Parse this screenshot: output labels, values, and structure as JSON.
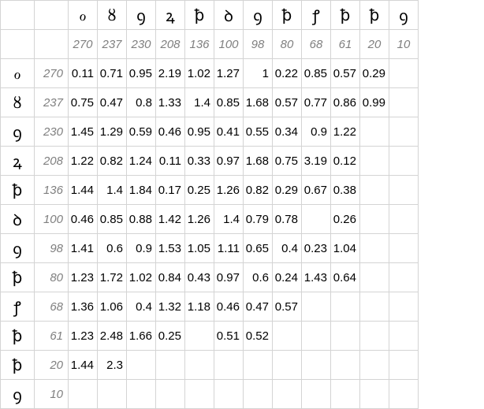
{
  "symbols": [
    "ℴ",
    "ȣ",
    "ꝯ",
    "ꝝ",
    "ꝥ",
    "ꝺ",
    "ꝯ",
    "ꝥ",
    "ꝭ",
    "ꝥ",
    "ꝥ",
    "ꝯ"
  ],
  "counts": [
    "270",
    "237",
    "230",
    "208",
    "136",
    "100",
    "98",
    "80",
    "68",
    "61",
    "20",
    "10"
  ],
  "rows": [
    [
      "0.11",
      "0.71",
      "0.95",
      "2.19",
      "1.02",
      "1.27",
      "1",
      "0.22",
      "0.85",
      "0.57",
      "0.29",
      ""
    ],
    [
      "0.75",
      "0.47",
      "0.8",
      "1.33",
      "1.4",
      "0.85",
      "1.68",
      "0.57",
      "0.77",
      "0.86",
      "0.99",
      ""
    ],
    [
      "1.45",
      "1.29",
      "0.59",
      "0.46",
      "0.95",
      "0.41",
      "0.55",
      "0.34",
      "0.9",
      "1.22",
      "",
      ""
    ],
    [
      "1.22",
      "0.82",
      "1.24",
      "0.11",
      "0.33",
      "0.97",
      "1.68",
      "0.75",
      "3.19",
      "0.12",
      "",
      ""
    ],
    [
      "1.44",
      "1.4",
      "1.84",
      "0.17",
      "0.25",
      "1.26",
      "0.82",
      "0.29",
      "0.67",
      "0.38",
      "",
      ""
    ],
    [
      "0.46",
      "0.85",
      "0.88",
      "1.42",
      "1.26",
      "1.4",
      "0.79",
      "0.78",
      "",
      "0.26",
      "",
      ""
    ],
    [
      "1.41",
      "0.6",
      "0.9",
      "1.53",
      "1.05",
      "1.11",
      "0.65",
      "0.4",
      "0.23",
      "1.04",
      "",
      ""
    ],
    [
      "1.23",
      "1.72",
      "1.02",
      "0.84",
      "0.43",
      "0.97",
      "0.6",
      "0.24",
      "1.43",
      "0.64",
      "",
      ""
    ],
    [
      "1.36",
      "1.06",
      "0.4",
      "1.32",
      "1.18",
      "0.46",
      "0.47",
      "0.57",
      "",
      "",
      "",
      ""
    ],
    [
      "1.23",
      "2.48",
      "1.66",
      "0.25",
      "",
      "0.51",
      "0.52",
      "",
      "",
      "",
      "",
      ""
    ],
    [
      "1.44",
      "2.3",
      "",
      "",
      "",
      "",
      "",
      "",
      "",
      "",
      "",
      ""
    ],
    [
      "",
      "",
      "",
      "",
      "",
      "",
      "",
      "",
      "",
      "",
      "",
      ""
    ]
  ]
}
